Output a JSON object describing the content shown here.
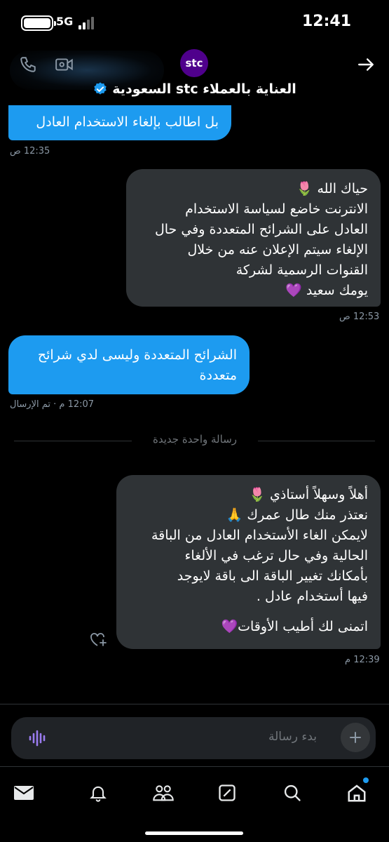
{
  "status": {
    "time": "12:41",
    "network": "5G"
  },
  "header": {
    "avatar_text": "stc",
    "title": "العناية بالعملاء stc السعودية",
    "avatar_color": "#4f008c"
  },
  "messages": [
    {
      "side": "sent",
      "text": "بل اطالب بإلغاء الاستخدام العادل",
      "time": "12:35 ص"
    },
    {
      "side": "received",
      "lines": [
        "حياك الله 🌷",
        "الانترنت خاضع لسياسة الاستخدام",
        "العادل على الشرائح المتعددة وفي حال",
        "الإلغاء سيتم الإعلان عنه من خلال",
        "القنوات الرسمية لشركة",
        "يومك سعيد 💜"
      ],
      "time": "12:53 ص"
    },
    {
      "side": "sent",
      "lines": [
        "الشرائح المتعددة وليسى لدي شرائح",
        "متعددة"
      ],
      "time": "12:07 م · تم الإرسال"
    },
    {
      "side": "received",
      "lines": [
        "أهلاً وسهلاً أستاذي 🌷",
        "نعتذر منك طال عمرك 🙏",
        "لايمكن الغاء الأستخدام العادل من الباقة",
        "الحالية وفي حال ترغب في الألغاء",
        "بأمكانك تغيير الباقة الى باقة لايوجد",
        "فيها أستخدام عادل .",
        "",
        "اتمنى لك أطيب الأوقات💜"
      ],
      "time": "12:39 م"
    }
  ],
  "divider_label": "رسالة واحدة جديدة",
  "composer": {
    "placeholder": "بدء رسالة"
  },
  "icons": {
    "header": [
      "phone-icon",
      "video-icon",
      "back-arrow-icon",
      "verified-badge-icon"
    ],
    "nav": [
      "mail-icon",
      "bell-icon",
      "people-icon",
      "grok-icon",
      "search-icon",
      "home-icon"
    ]
  },
  "colors": {
    "sent_bubble": "#1d9bf0",
    "received_bubble": "#2f3336",
    "background": "#000000"
  }
}
